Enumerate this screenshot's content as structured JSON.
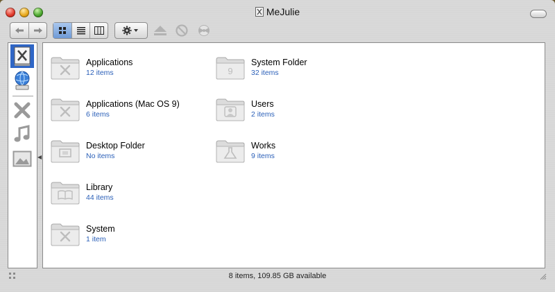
{
  "window": {
    "title": "MeJulie"
  },
  "toolbar": {
    "back_icon": "back-arrow-icon",
    "forward_icon": "forward-arrow-icon",
    "views": [
      "icon-view-icon",
      "list-view-icon",
      "column-view-icon"
    ],
    "action_icon": "gear-icon",
    "eject_icon": "eject-icon",
    "burn_icon": "burn-icon"
  },
  "sidebar": {
    "items": [
      {
        "name": "mejulie-disk",
        "icon": "hard-disk-icon",
        "selected": true
      },
      {
        "name": "network",
        "icon": "network-globe-icon",
        "selected": false
      },
      {
        "name": "applications",
        "icon": "applications-icon",
        "selected": false
      },
      {
        "name": "music",
        "icon": "music-note-icon",
        "selected": false
      },
      {
        "name": "pictures",
        "icon": "pictures-icon",
        "selected": false
      }
    ]
  },
  "items": [
    {
      "name": "Applications",
      "count": "12 items",
      "badge": "x"
    },
    {
      "name": "Applications (Mac OS 9)",
      "count": "6 items",
      "badge": "x"
    },
    {
      "name": "Desktop Folder",
      "count": "No items",
      "badge": "desk"
    },
    {
      "name": "Library",
      "count": "44 items",
      "badge": "book"
    },
    {
      "name": "System",
      "count": "1 item",
      "badge": "x"
    },
    {
      "name": "System Folder",
      "count": "32 items",
      "badge": "9"
    },
    {
      "name": "Users",
      "count": "2 items",
      "badge": "user"
    },
    {
      "name": "Works",
      "count": "9 items",
      "badge": "flask"
    }
  ],
  "status": {
    "text": "8 items, 109.85 GB available"
  },
  "colors": {
    "selection": "#2f66c6",
    "count_text": "#2a5fb8"
  }
}
